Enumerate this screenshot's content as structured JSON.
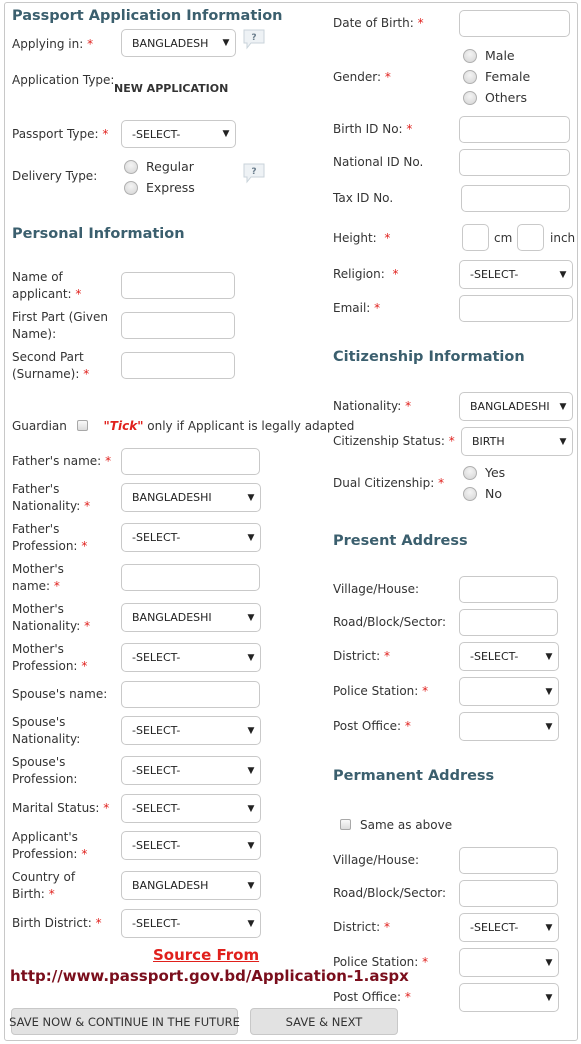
{
  "passport_section": {
    "title": "Passport Application Information",
    "applying_in": {
      "label": "Applying in:",
      "value": "BANGLADESH"
    },
    "application_type": {
      "label": "Application Type:",
      "value": "NEW APPLICATION"
    },
    "passport_type": {
      "label": "Passport Type:",
      "value": "-SELECT-"
    },
    "delivery_type": {
      "label": "Delivery Type:",
      "options": [
        "Regular",
        "Express"
      ]
    }
  },
  "personal_section": {
    "title": "Personal Information",
    "name_of_applicant": {
      "label1": "Name of",
      "label2": "applicant:",
      "value": ""
    },
    "first_part": {
      "label1": "First Part (Given",
      "label2": "Name):",
      "value": ""
    },
    "second_part": {
      "label1": "Second Part",
      "label2": "(Surname):",
      "value": ""
    },
    "guardian": {
      "label": "Guardian",
      "tick_word": "\"Tick\"",
      "note": " only if Applicant is legally adapted"
    },
    "fathers_name": {
      "label": "Father's name:",
      "value": ""
    },
    "fathers_nationality": {
      "label1": "Father's",
      "label2": "Nationality:",
      "value": "BANGLADESHI"
    },
    "fathers_profession": {
      "label1": "Father's",
      "label2": "Profession:",
      "value": "-SELECT-"
    },
    "mothers_name": {
      "label1": "Mother's",
      "label2": "name:",
      "value": ""
    },
    "mothers_nationality": {
      "label1": "Mother's",
      "label2": "Nationality:",
      "value": "BANGLADESHI"
    },
    "mothers_profession": {
      "label1": "Mother's",
      "label2": "Profession:",
      "value": "-SELECT-"
    },
    "spouses_name": {
      "label": "Spouse's name:",
      "value": ""
    },
    "spouses_nationality": {
      "label1": "Spouse's",
      "label2": "Nationality:",
      "value": "-SELECT-"
    },
    "spouses_profession": {
      "label1": "Spouse's",
      "label2": "Profession:",
      "value": "-SELECT-"
    },
    "marital_status": {
      "label": "Marital Status:",
      "value": "-SELECT-"
    },
    "applicants_profession": {
      "label1": "Applicant's",
      "label2": "Profession:",
      "value": "-SELECT-"
    },
    "country_of_birth": {
      "label1": "Country of",
      "label2": "Birth:",
      "value": "BANGLADESH"
    },
    "birth_district": {
      "label": "Birth District:",
      "value": "-SELECT-"
    }
  },
  "right_personal": {
    "date_of_birth": {
      "label": "Date of Birth:",
      "value": ""
    },
    "gender": {
      "label": "Gender:",
      "options": [
        "Male",
        "Female",
        "Others"
      ]
    },
    "birth_id": {
      "label": "Birth ID No:",
      "value": ""
    },
    "national_id": {
      "label": "National ID No.",
      "value": ""
    },
    "tax_id": {
      "label": "Tax ID No.",
      "value": ""
    },
    "height": {
      "label": "Height:",
      "unit_cm": "cm",
      "unit_inch": "inch"
    },
    "religion": {
      "label": "Religion:",
      "value": "-SELECT-"
    },
    "email": {
      "label": "Email:",
      "value": ""
    }
  },
  "citizenship_section": {
    "title": "Citizenship Information",
    "nationality": {
      "label": "Nationality:",
      "value": "BANGLADESHI"
    },
    "status": {
      "label": "Citizenship Status:",
      "value": "BIRTH"
    },
    "dual": {
      "label": "Dual Citizenship:",
      "options": [
        "Yes",
        "No"
      ]
    }
  },
  "present_address": {
    "title": "Present Address",
    "village": {
      "label": "Village/House:"
    },
    "road": {
      "label": "Road/Block/Sector:"
    },
    "district": {
      "label": "District:",
      "value": "-SELECT-"
    },
    "police_station": {
      "label": "Police Station:",
      "value": ""
    },
    "post_office": {
      "label": "Post Office:",
      "value": ""
    }
  },
  "permanent_address": {
    "title": "Permanent Address",
    "same_as_above": "Same as above",
    "village": {
      "label": "Village/House:"
    },
    "road": {
      "label": "Road/Block/Sector:"
    },
    "district": {
      "label": "District:",
      "value": "-SELECT-"
    },
    "police_station": {
      "label": "Police Station:",
      "value": ""
    },
    "post_office": {
      "label": "Post Office:",
      "value": ""
    }
  },
  "source": {
    "title": "Source From",
    "url": "http://www.passport.gov.bd/Application-1.aspx"
  },
  "buttons": {
    "save_later": "SAVE NOW & CONTINUE IN THE FUTURE",
    "save_next": "SAVE & NEXT"
  },
  "required_mark": "*",
  "help_icon_text": "?"
}
